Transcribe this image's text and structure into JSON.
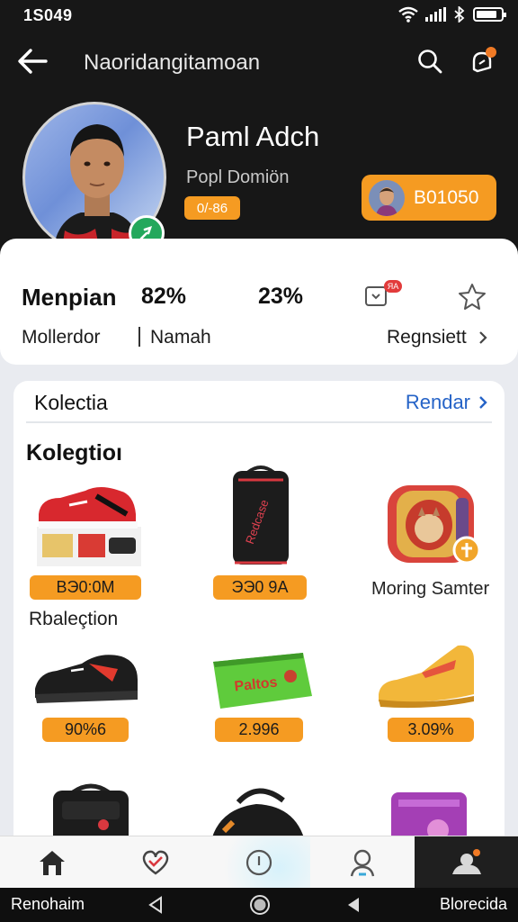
{
  "status": {
    "time": "1S049"
  },
  "app_bar": {
    "title": "Naoridangitamoan"
  },
  "profile": {
    "name": "Paml Adch",
    "subtitle": "Popl Domiön",
    "level": "0/-86",
    "coins": "B01050",
    "accent_color": "#f59b22",
    "verified_color": "#23a85c"
  },
  "stats": {
    "title": "Menpian",
    "pct1": "82%",
    "pct2": "23%",
    "message_badge": "ЯA",
    "label1": "Mollerdor",
    "label2": "Namah",
    "link": "Regnsiett"
  },
  "collection": {
    "header_title": "Kolectia",
    "header_link": "Rendar",
    "section_title": "Kolegtioı",
    "row_label": "Rbaleçtion",
    "products": [
      {
        "kind": "sneaker-red",
        "price": "BЭ0:0M"
      },
      {
        "kind": "tall-bag",
        "price": "ЭЭ0 9A"
      },
      {
        "kind": "badge",
        "caption": "Moring Samter"
      },
      {
        "kind": "sneaker-black",
        "price": "90%6"
      },
      {
        "kind": "green-bag",
        "price": "2.996"
      },
      {
        "kind": "yellow-shoe",
        "price": "3.09%"
      }
    ],
    "link_color": "#2563c7"
  },
  "bottom_nav": {
    "items": [
      "home-icon",
      "heart-check-icon",
      "clock-icon",
      "profile-icon",
      "user-settings-icon"
    ]
  },
  "system_bar": {
    "left": "Renohaim",
    "right": "Blorecida"
  }
}
